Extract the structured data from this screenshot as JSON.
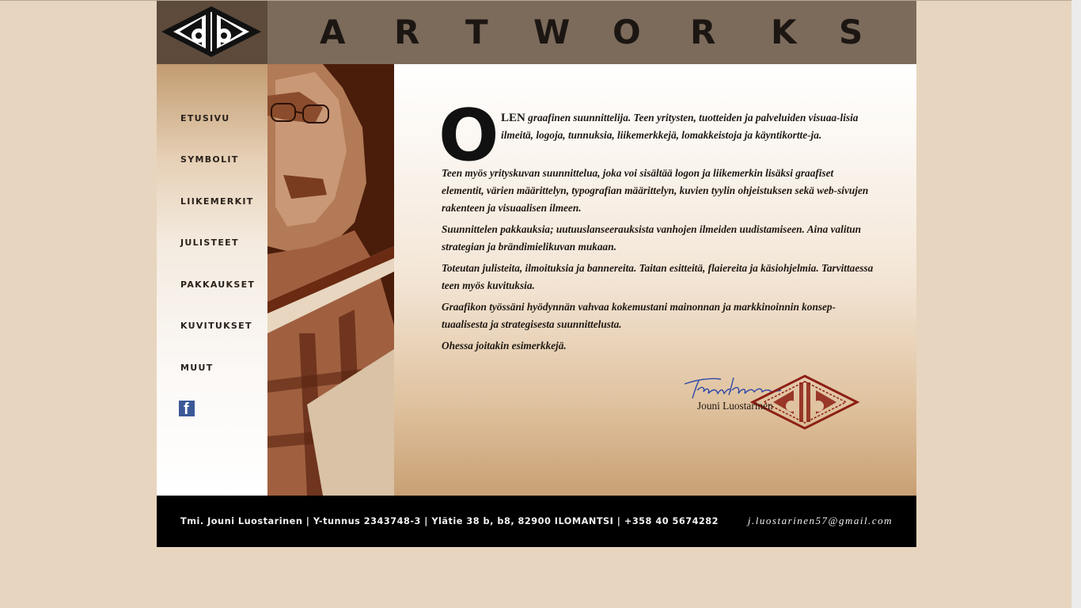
{
  "header": {
    "title_letters": [
      "A",
      "R",
      "T",
      "W",
      "O",
      "R",
      "K",
      "S"
    ],
    "logo_icon": "db-diamond-logo"
  },
  "nav": {
    "items": [
      {
        "label": "ETUSIVU"
      },
      {
        "label": "SYMBOLIT"
      },
      {
        "label": "LIIKEMERKIT"
      },
      {
        "label": "JULISTEET"
      },
      {
        "label": "PAKKAUKSET"
      },
      {
        "label": "KUVITUKSET"
      },
      {
        "label": "MUUT"
      }
    ],
    "facebook_icon": "facebook-icon"
  },
  "content": {
    "dropcap": "O",
    "lead": "LEN",
    "intro": "graafinen suunnittelija. Teen yritysten, tuotteiden ja palveluiden visuaa-lisia ilmeitä, logoja, tunnuksia, liikemerkkejä, lomakkeistoja ja käyntikortte-ja.",
    "paragraphs": [
      "Teen myös yrityskuvan suunnittelua, joka voi sisältää logon ja liikemerkin lisäksi graafiset elementit, värien määrittelyn, typografian määrittelyn, kuvien tyylin ohjeistuksen sekä web-sivujen rakenteen ja visuaalisen ilmeen.",
      "Suunnittelen pakkauksia; uutuuslanseerauksista vanhojen ilmeiden uudistamiseen. Aina valitun strategian ja brändimielikuvan mukaan.",
      "Toteutan julisteita, ilmoituksia ja bannereita. Taitan esitteitä, flaiereita ja käsiohjelmia. Tarvittaessa teen myös kuvituksia.",
      "Graafikon työssäni hyödynnän vahvaa kokemustani mainonnan ja markkinoinnin konsep-tuaalisesta ja strategisesta suunnittelusta.",
      "Ohessa joitakin esimerkkejä."
    ],
    "signature_name": "Jouni Luostarinen"
  },
  "footer": {
    "company_info": "Tmi. Jouni Luostarinen | Y-tunnus 2343748-3 | Ylätie 38 b, b8, 82900 ILOMANTSI | +358 40 5674282",
    "email": "j.luostarinen57@gmail.com"
  },
  "colors": {
    "background": "#e7d5bf",
    "header": "#7c6b5b",
    "logo_box": "#5d4a3b",
    "photo_dark": "#4a1c0a",
    "footer": "#000000",
    "stamp": "#8c1f14",
    "signature_ink": "#2f49a8"
  }
}
